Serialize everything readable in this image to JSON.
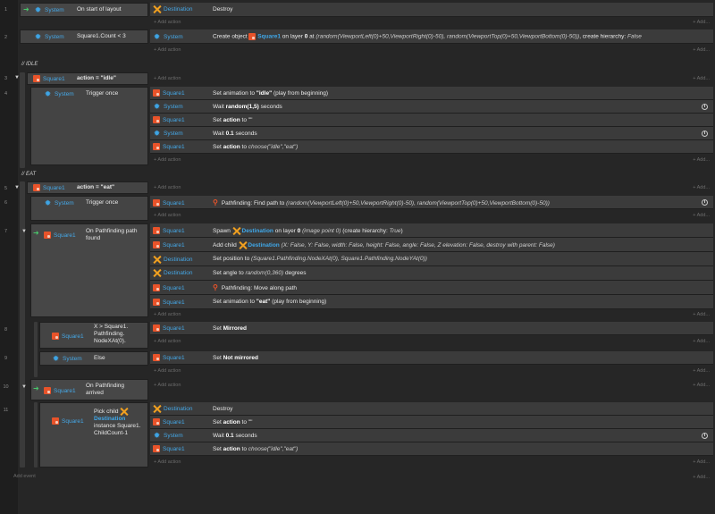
{
  "add_action": "+ Add action",
  "add_small": "+ Add...",
  "add_event": "Add event",
  "comments": {
    "idle": "//  IDLE",
    "eat": "//  EAT"
  },
  "rows": {
    "r1": "1",
    "r2": "2",
    "r3": "3",
    "r4": "4",
    "r5": "5",
    "r6": "6",
    "r7": "7",
    "r8": "8",
    "r9": "9",
    "r10": "10",
    "r11": "11"
  },
  "objects": {
    "system": "System",
    "square1": "Square1",
    "destination": "Destination"
  },
  "conditions": {
    "e1": "On start of layout",
    "e2": "Square1.Count < 3",
    "e3": "action = \"idle\"",
    "e4": "Trigger once",
    "e5": "action = \"eat\"",
    "e6": "Trigger once",
    "e7": "On  Pathfinding path found",
    "e8": "X > Square1. Pathfinding. NodeXAt(0).",
    "e9": "Else",
    "e10": "On  Pathfinding arrived",
    "e11_a": "Pick child",
    "e11_b": "Destination",
    "e11_c": "instance Square1. ChildCount-1"
  },
  "actions": {
    "a1_1": "Destroy",
    "a2_1_pre": "Create object",
    "a2_1_obj": "Square1",
    "a2_1_mid": "on layer",
    "a2_1_layer": "0",
    "a2_1_at": "at",
    "a2_1_expr": "(random(ViewportLeft(0)+50,ViewportRight(0)-50), random(ViewportTop(0)+50,ViewportBottom(0)-50))",
    "a2_1_post": ", create hierarchy:",
    "a2_1_false": "False",
    "a4_1_pre": "Set animation to",
    "a4_1_val": "\"idle\"",
    "a4_1_post": "(play from beginning)",
    "a4_2_pre": "Wait",
    "a4_2_val": "random(1,5)",
    "a4_2_post": "seconds",
    "a4_3_pre": "Set",
    "a4_3_val": "action",
    "a4_3_post": "to \"\"",
    "a4_4_pre": "Wait",
    "a4_4_val": "0.1",
    "a4_4_post": "seconds",
    "a4_5_pre": "Set",
    "a4_5_val": "action",
    "a4_5_post": "to",
    "a4_5_expr": "choose(\"idle\",\"eat\")",
    "a6_1_pre": "Pathfinding: Find path to",
    "a6_1_expr": "(random(ViewportLeft(0)+50,ViewportRight(0)-50), random(ViewportTop(0)+50,ViewportBottom(0)-50))",
    "a7_1_pre": "Spawn",
    "a7_1_obj": "Destination",
    "a7_1_mid": "on layer",
    "a7_1_layer": "0",
    "a7_1_note": "(image point 0)",
    "a7_1_post": "(create hierarchy:",
    "a7_1_true": "True",
    "a7_2_pre": "Add child",
    "a7_2_obj": "Destination",
    "a7_2_rest": "(X: False, Y: False, width: False, height: False, angle: False, Z elevation: False, destroy with parent: False)",
    "a7_3_pre": "Set position to",
    "a7_3_expr": "(Square1.Pathfinding.NodeXAt(0), Square1.Pathfinding.NodeYAt(0))",
    "a7_4_pre": "Set angle to",
    "a7_4_expr": "random(0,360)",
    "a7_4_post": "degrees",
    "a7_5": "Pathfinding: Move along path",
    "a7_6_pre": "Set animation to",
    "a7_6_val": "\"eat\"",
    "a7_6_post": "(play from beginning)",
    "a8_1_pre": "Set",
    "a8_1_val": "Mirrored",
    "a9_1_pre": "Set",
    "a9_1_val": "Not mirrored",
    "a11_1": "Destroy",
    "a11_2_pre": "Set",
    "a11_2_val": "action",
    "a11_2_post": "to \"\"",
    "a11_3_pre": "Wait",
    "a11_3_val": "0.1",
    "a11_3_post": "seconds",
    "a11_4_pre": "Set",
    "a11_4_val": "action",
    "a11_4_post": "to",
    "a11_4_expr": "choose(\"idle\",\"eat\")"
  },
  "icons": {
    "system": "gear-icon",
    "square1": "square1-sprite-icon",
    "destination": "destination-cross-icon",
    "pathfinding": "pathfinding-icon",
    "wait": "timer-icon",
    "trigger": "trigger-arrow-icon"
  },
  "colors": {
    "background": "#262626",
    "condition_bg": "#444444",
    "action_bg": "#3b3b3b",
    "system_blue": "#3ea4e4",
    "sprite_orange": "#e8532a",
    "destination_orange": "#f0a020",
    "trigger_green": "#49c66b"
  }
}
